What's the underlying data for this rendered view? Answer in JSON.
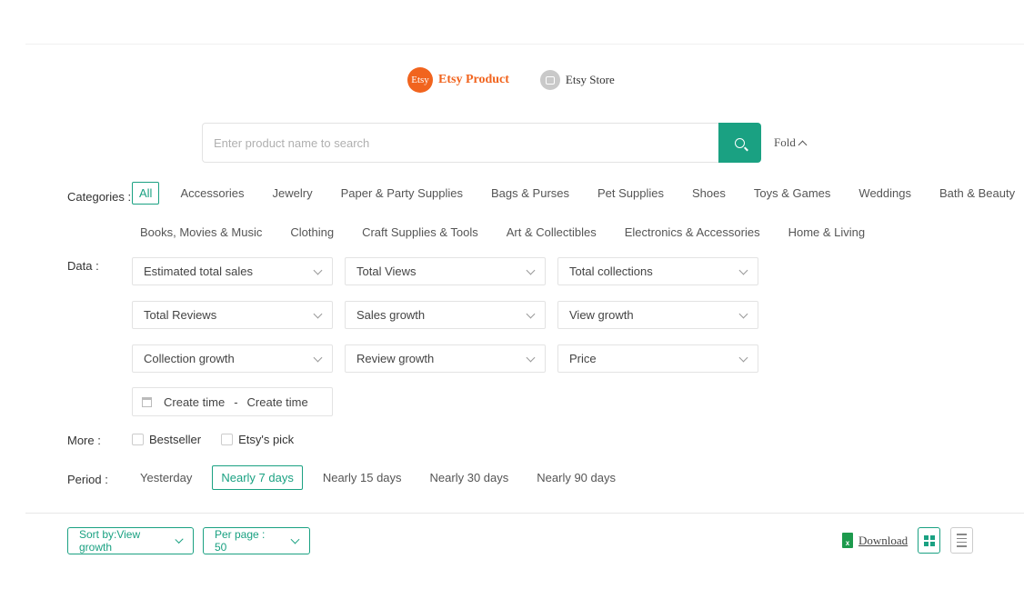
{
  "source_tabs": {
    "product": {
      "badge": "Etsy",
      "label": "Etsy Product"
    },
    "store": {
      "label": "Etsy Store"
    }
  },
  "search": {
    "placeholder": "Enter product name to search",
    "fold_label": "Fold"
  },
  "filters": {
    "categories_label": "Categories :",
    "categories_row1": [
      "All",
      "Accessories",
      "Jewelry",
      "Paper & Party Supplies",
      "Bags & Purses",
      "Pet Supplies",
      "Shoes",
      "Toys & Games",
      "Weddings",
      "Bath & Beauty"
    ],
    "categories_row2": [
      "Books, Movies & Music",
      "Clothing",
      "Craft Supplies & Tools",
      "Art & Collectibles",
      "Electronics & Accessories",
      "Home & Living"
    ],
    "data_label": "Data :",
    "data_selects": [
      "Estimated total sales",
      "Total Views",
      "Total collections",
      "Total Reviews",
      "Sales growth",
      "View growth",
      "Collection growth",
      "Review growth",
      "Price"
    ],
    "date_range": {
      "start": "Create time",
      "separator": "-",
      "end": "Create time"
    },
    "more_label": "More :",
    "more_options": [
      "Bestseller",
      "Etsy's pick"
    ],
    "period_label": "Period :",
    "periods": [
      "Yesterday",
      "Nearly 7 days",
      "Nearly 15 days",
      "Nearly 30 days",
      "Nearly 90 days"
    ],
    "active_period": "Nearly 7 days"
  },
  "toolbar": {
    "sort_label": "Sort by:View growth",
    "per_page_label": "Per page : 50",
    "download_label": "Download"
  },
  "colors": {
    "accent": "#1aa182",
    "etsy_orange": "#f1641e"
  }
}
